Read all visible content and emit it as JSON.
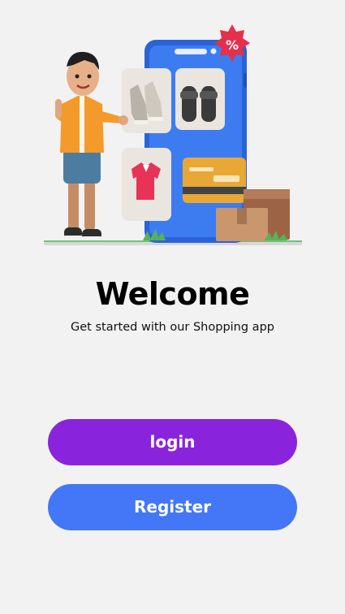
{
  "welcome": {
    "title": "Welcome",
    "subtitle": "Get started with our Shopping app"
  },
  "actions": {
    "login_label": "login",
    "register_label": "Register"
  },
  "hero": {
    "badge_text": "%",
    "icons": [
      "shopping-phone-illustration",
      "sneaker-icon",
      "sandal-icon",
      "shirt-icon",
      "credit-card-icon",
      "cardboard-box-icon",
      "discount-badge-icon",
      "person-illustration"
    ]
  },
  "colors": {
    "background": "#f2f2f2",
    "login_button": "#8a24dc",
    "register_button": "#4377f7",
    "phone": "#2f6ee8"
  }
}
